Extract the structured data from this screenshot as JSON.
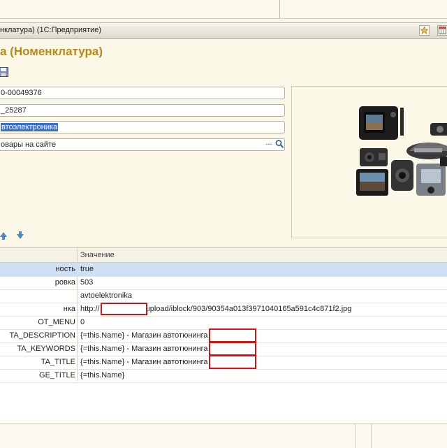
{
  "window": {
    "title": "нклатура)  (1С:Предприятие)"
  },
  "form": {
    "header": "а (Номенклатура)"
  },
  "fields": {
    "code": "0-00049376",
    "article": "_25287",
    "name": "втоэлектроника",
    "group": "овары на сайте",
    "group_button": "..."
  },
  "grid": {
    "value_header": "Значение",
    "rows": [
      {
        "key": "ность",
        "value": "true"
      },
      {
        "key": "ровка",
        "value": "503"
      },
      {
        "key": "",
        "value": "avtoelektronika"
      },
      {
        "key": "нка",
        "value_prefix": "http://",
        "value_suffix": "/upload/iblock/903/90354a013f3971040165a591c4c871f2.jpg"
      },
      {
        "key": "OT_MENU",
        "value": "0"
      },
      {
        "key": "TA_DESCRIPTION",
        "value": "{=this.Name} - Магазин автотюнинга"
      },
      {
        "key": "TA_KEYWORDS",
        "value": "{=this.Name} - Магазин автотюнинга"
      },
      {
        "key": "TA_TITLE",
        "value": "{=this.Name} - Магазин автотюнинга"
      },
      {
        "key": "GE_TITLE",
        "value": "{=this.Name}"
      }
    ]
  },
  "colors": {
    "header_text": "#b7881a",
    "selection": "#3a6fcf",
    "redaction_border": "#d11414",
    "active_row": "#cfe0f5"
  },
  "icons": [
    "save-icon",
    "star-icon",
    "calendar-icon",
    "search-icon",
    "arrow-up-icon",
    "arrow-down-icon"
  ]
}
